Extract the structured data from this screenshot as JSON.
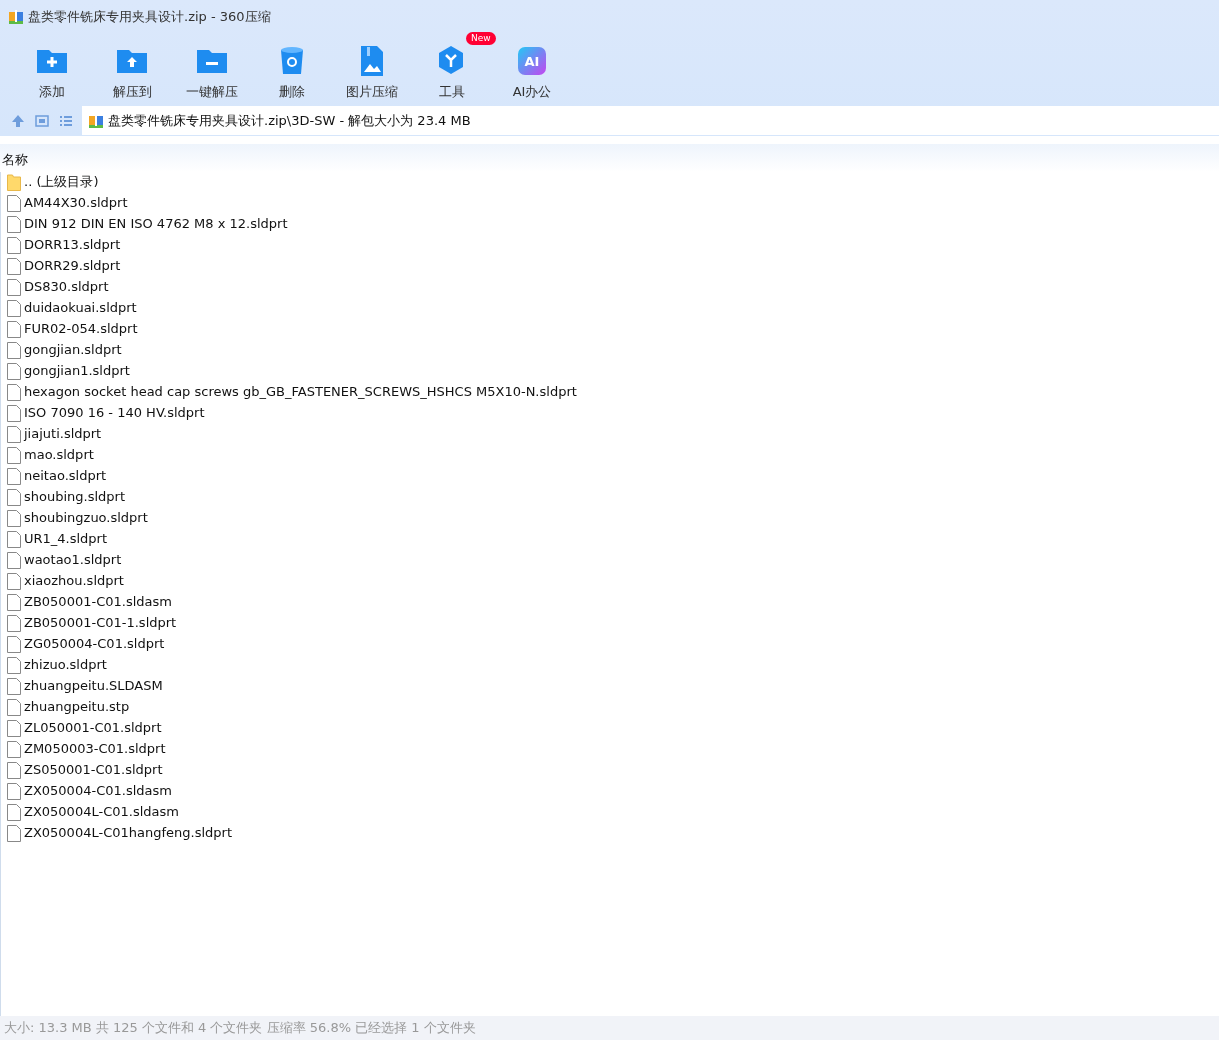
{
  "window": {
    "title": "盘类零件铣床专用夹具设计.zip - 360压缩"
  },
  "toolbar": [
    {
      "kind": "add",
      "label": "添加"
    },
    {
      "kind": "extract",
      "label": "解压到"
    },
    {
      "kind": "oneclick",
      "label": "一键解压"
    },
    {
      "kind": "delete",
      "label": "删除"
    },
    {
      "kind": "image",
      "label": "图片压缩"
    },
    {
      "kind": "tools",
      "label": "工具",
      "badge": "New"
    },
    {
      "kind": "ai",
      "label": "AI办公",
      "icon_text": "AI"
    }
  ],
  "address": {
    "path": "盘类零件铣床专用夹具设计.zip\\3D-SW - 解包大小为 23.4 MB"
  },
  "table": {
    "columns": [
      "名称"
    ],
    "rows": [
      {
        "kind": "folder",
        "name": ".. (上级目录)"
      },
      {
        "kind": "file",
        "name": "AM44X30.sldprt"
      },
      {
        "kind": "file",
        "name": "DIN 912 DIN EN ISO 4762 M8 x 12.sldprt"
      },
      {
        "kind": "file",
        "name": "DORR13.sldprt"
      },
      {
        "kind": "file",
        "name": "DORR29.sldprt"
      },
      {
        "kind": "file",
        "name": "DS830.sldprt"
      },
      {
        "kind": "file",
        "name": "duidaokuai.sldprt"
      },
      {
        "kind": "file",
        "name": "FUR02-054.sldprt"
      },
      {
        "kind": "file",
        "name": "gongjian.sldprt"
      },
      {
        "kind": "file",
        "name": "gongjian1.sldprt"
      },
      {
        "kind": "file",
        "name": "hexagon socket head cap screws gb_GB_FASTENER_SCREWS_HSHCS M5X10-N.sldprt"
      },
      {
        "kind": "file",
        "name": "ISO 7090 16 - 140 HV.sldprt"
      },
      {
        "kind": "file",
        "name": "jiajuti.sldprt"
      },
      {
        "kind": "file",
        "name": "mao.sldprt"
      },
      {
        "kind": "file",
        "name": "neitao.sldprt"
      },
      {
        "kind": "file",
        "name": "shoubing.sldprt"
      },
      {
        "kind": "file",
        "name": "shoubingzuo.sldprt"
      },
      {
        "kind": "file",
        "name": "UR1_4.sldprt"
      },
      {
        "kind": "file",
        "name": "waotao1.sldprt"
      },
      {
        "kind": "file",
        "name": "xiaozhou.sldprt"
      },
      {
        "kind": "file",
        "name": "ZB050001-C01.sldasm"
      },
      {
        "kind": "file",
        "name": "ZB050001-C01-1.sldprt"
      },
      {
        "kind": "file",
        "name": "ZG050004-C01.sldprt"
      },
      {
        "kind": "file",
        "name": "zhizuo.sldprt"
      },
      {
        "kind": "file",
        "name": "zhuangpeitu.SLDASM"
      },
      {
        "kind": "file",
        "name": "zhuangpeitu.stp"
      },
      {
        "kind": "file",
        "name": "ZL050001-C01.sldprt"
      },
      {
        "kind": "file",
        "name": "ZM050003-C01.sldprt"
      },
      {
        "kind": "file",
        "name": "ZS050001-C01.sldprt"
      },
      {
        "kind": "file",
        "name": "ZX050004-C01.sldasm"
      },
      {
        "kind": "file",
        "name": "ZX050004L-C01.sldasm"
      },
      {
        "kind": "file",
        "name": "ZX050004L-C01hangfeng.sldprt"
      }
    ]
  },
  "status_bar": "大小: 13.3 MB 共 125 个文件和 4 个文件夹 压缩率 56.8% 已经选择 1 个文件夹"
}
